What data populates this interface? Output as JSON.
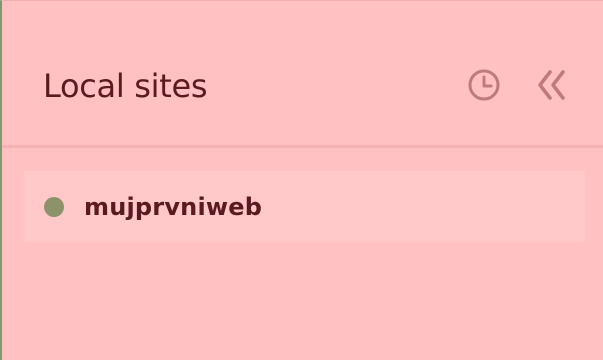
{
  "panel": {
    "title": "Local sites",
    "icons": {
      "history": "clock-icon",
      "collapse": "double-chevron-left-icon"
    }
  },
  "sites": [
    {
      "name": "mujprvniweb",
      "status": "running",
      "status_color": "#8c936a"
    }
  ],
  "colors": {
    "background": "#ffc1c1",
    "item_background": "#ffc9c9",
    "text": "#5a1a20",
    "icon": "#c07a7a",
    "divider": "#f5b3b3",
    "accent_border": "#7f9b6a"
  }
}
